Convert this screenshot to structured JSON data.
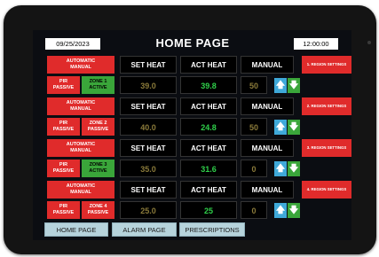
{
  "header": {
    "date": "09/25/2023",
    "title": "HOME PAGE",
    "time": "12:00:00"
  },
  "zones": [
    {
      "auto_label_1": "AUTOMATIC",
      "auto_label_2": "MANUAL",
      "set_heat_header": "SET HEAT",
      "act_heat_header": "ACT HEAT",
      "manual_header": "MANUAL",
      "region_settings": "1. REGION SETTINGS",
      "pir_1": "PIR",
      "pir_2": "PASSIVE",
      "zone_1": "ZONE 1",
      "zone_2": "ACTIVE",
      "zone_state": "active",
      "set_heat": "39.0",
      "act_heat": "39.8",
      "manual": "50"
    },
    {
      "auto_label_1": "AUTOMATIC",
      "auto_label_2": "MANUAL",
      "set_heat_header": "SET HEAT",
      "act_heat_header": "ACT HEAT",
      "manual_header": "MANUAL",
      "region_settings": "2. REGION SETTINGS",
      "pir_1": "PIR",
      "pir_2": "PASSIVE",
      "zone_1": "ZONE 2",
      "zone_2": "PASSIVE",
      "zone_state": "passive",
      "set_heat": "40.0",
      "act_heat": "24.8",
      "manual": "50"
    },
    {
      "auto_label_1": "AUTOMATIC",
      "auto_label_2": "MANUAL",
      "set_heat_header": "SET HEAT",
      "act_heat_header": "ACT HEAT",
      "manual_header": "MANUAL",
      "region_settings": "3. REGION SETTINGS",
      "pir_1": "PIR",
      "pir_2": "PASSIVE",
      "zone_1": "ZONE 3",
      "zone_2": "ACTIVE",
      "zone_state": "active",
      "set_heat": "35.0",
      "act_heat": "31.6",
      "manual": "0"
    },
    {
      "auto_label_1": "AUTOMATIC",
      "auto_label_2": "MANUAL",
      "set_heat_header": "SET HEAT",
      "act_heat_header": "ACT HEAT",
      "manual_header": "MANUAL",
      "region_settings": "4. REGION SETTINGS",
      "pir_1": "PIR",
      "pir_2": "PASSIVE",
      "zone_1": "ZONE 4",
      "zone_2": "PASSIVE",
      "zone_state": "passive",
      "set_heat": "25.0",
      "act_heat": "25",
      "manual": "0"
    }
  ],
  "icons": {
    "up": "arrow-up-icon",
    "down": "arrow-down-icon"
  },
  "colors": {
    "alarm_red": "#e02b2b",
    "active_green": "#3aa63a",
    "up_blue": "#3fa9d9",
    "act_value_green": "#2fd04a",
    "nav_bg": "#b6d3dc"
  },
  "nav": {
    "home": "HOME PAGE",
    "alarm": "ALARM PAGE",
    "prescriptions": "PRESCRIPTIONS"
  }
}
